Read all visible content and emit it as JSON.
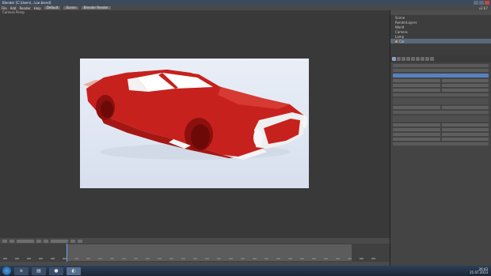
{
  "window": {
    "title": "Blender [C:\\Users\\...\\car.blend]"
  },
  "menubar": {
    "items": [
      "File",
      "Add",
      "Render",
      "Help"
    ],
    "layout": "Default",
    "scene": "Scene",
    "engine": "Blender Render",
    "version": "v2.67"
  },
  "viewport": {
    "header": "Camera Persp"
  },
  "outliner": {
    "items": [
      "Scene",
      "RenderLayers",
      "World",
      "Camera",
      "Lamp",
      "Car"
    ]
  },
  "taskbar": {
    "time": "20:43",
    "date": "21.07.2013"
  },
  "colors": {
    "car_red": "#c5201c",
    "selection": "#5881c0"
  },
  "icons": [
    "windows-start-icon",
    "ie-icon",
    "explorer-icon",
    "chrome-icon",
    "blender-icon"
  ]
}
